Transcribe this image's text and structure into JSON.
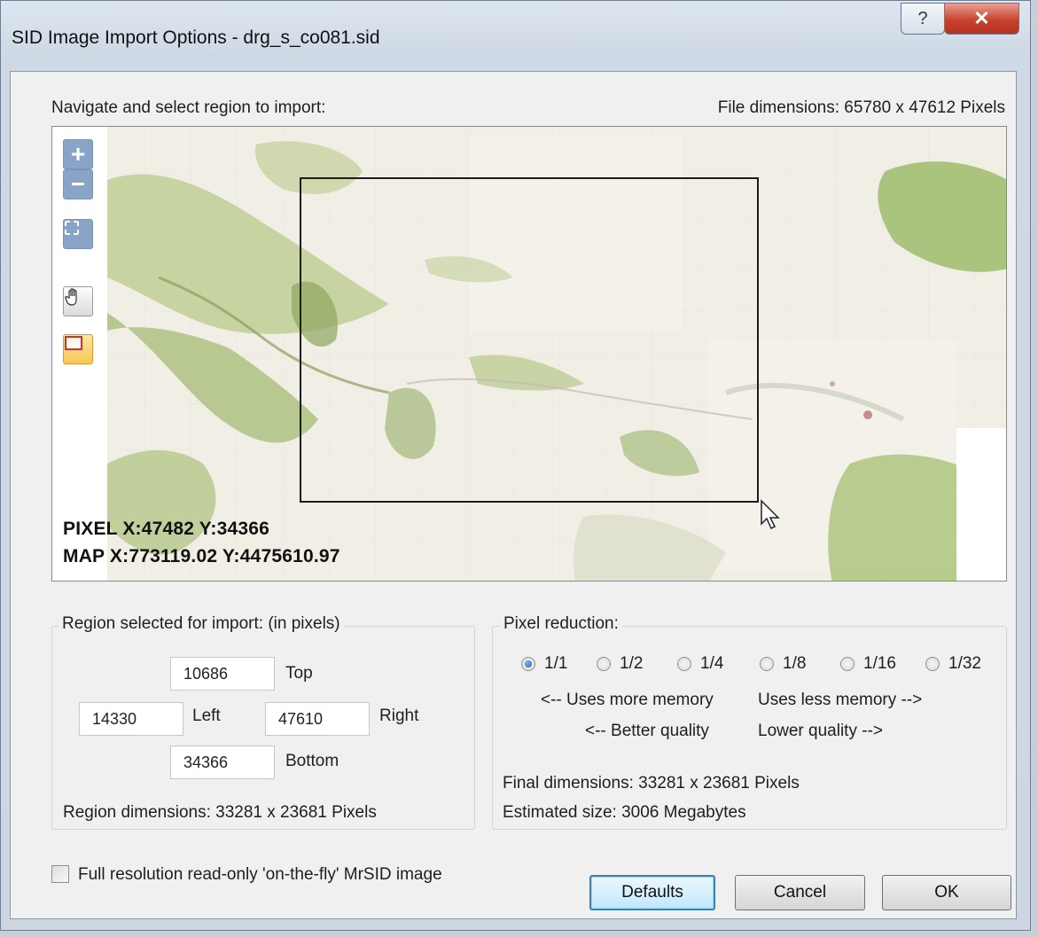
{
  "window": {
    "title": "SID Image Import Options - drg_s_co081.sid",
    "help_icon": "question-mark-icon",
    "close_icon": "x-close-icon"
  },
  "map_panel": {
    "label": "Navigate and select region to import:",
    "file_dimensions": "File dimensions:  65780 x 47612 Pixels",
    "pixel_readout": "PIXEL  X:47482  Y:34366",
    "map_readout": "MAP  X:773119.02  Y:4475610.97",
    "tools": {
      "zoom_in": "+",
      "zoom_out": "−",
      "fit_icon": "expand-icon",
      "pan_icon": "hand-icon",
      "select_icon": "rectangle-select-icon"
    }
  },
  "region": {
    "title": "Region selected for import:  (in pixels)",
    "top_value": "10686",
    "top_label": "Top",
    "left_value": "14330",
    "left_label": "Left",
    "right_value": "47610",
    "right_label": "Right",
    "bottom_value": "34366",
    "bottom_label": "Bottom",
    "dimensions": "Region dimensions:  33281 x 23681 Pixels"
  },
  "pixel_reduction": {
    "title": "Pixel reduction:",
    "options": [
      {
        "label": "1/1",
        "selected": true
      },
      {
        "label": "1/2",
        "selected": false
      },
      {
        "label": "1/4",
        "selected": false
      },
      {
        "label": "1/8",
        "selected": false
      },
      {
        "label": "1/16",
        "selected": false
      },
      {
        "label": "1/32",
        "selected": false
      }
    ],
    "more_memory": "<-- Uses more memory",
    "less_memory": "Uses less memory -->",
    "better_quality": "<-- Better quality",
    "lower_quality": "Lower quality -->",
    "final_dimensions": "Final dimensions:  33281 x 23681 Pixels",
    "estimated_size": "Estimated size:  3006 Megabytes"
  },
  "footer": {
    "checkbox_label": "Full resolution read-only 'on-the-fly' MrSID image",
    "defaults_label": "Defaults",
    "cancel_label": "Cancel",
    "ok_label": "OK"
  }
}
